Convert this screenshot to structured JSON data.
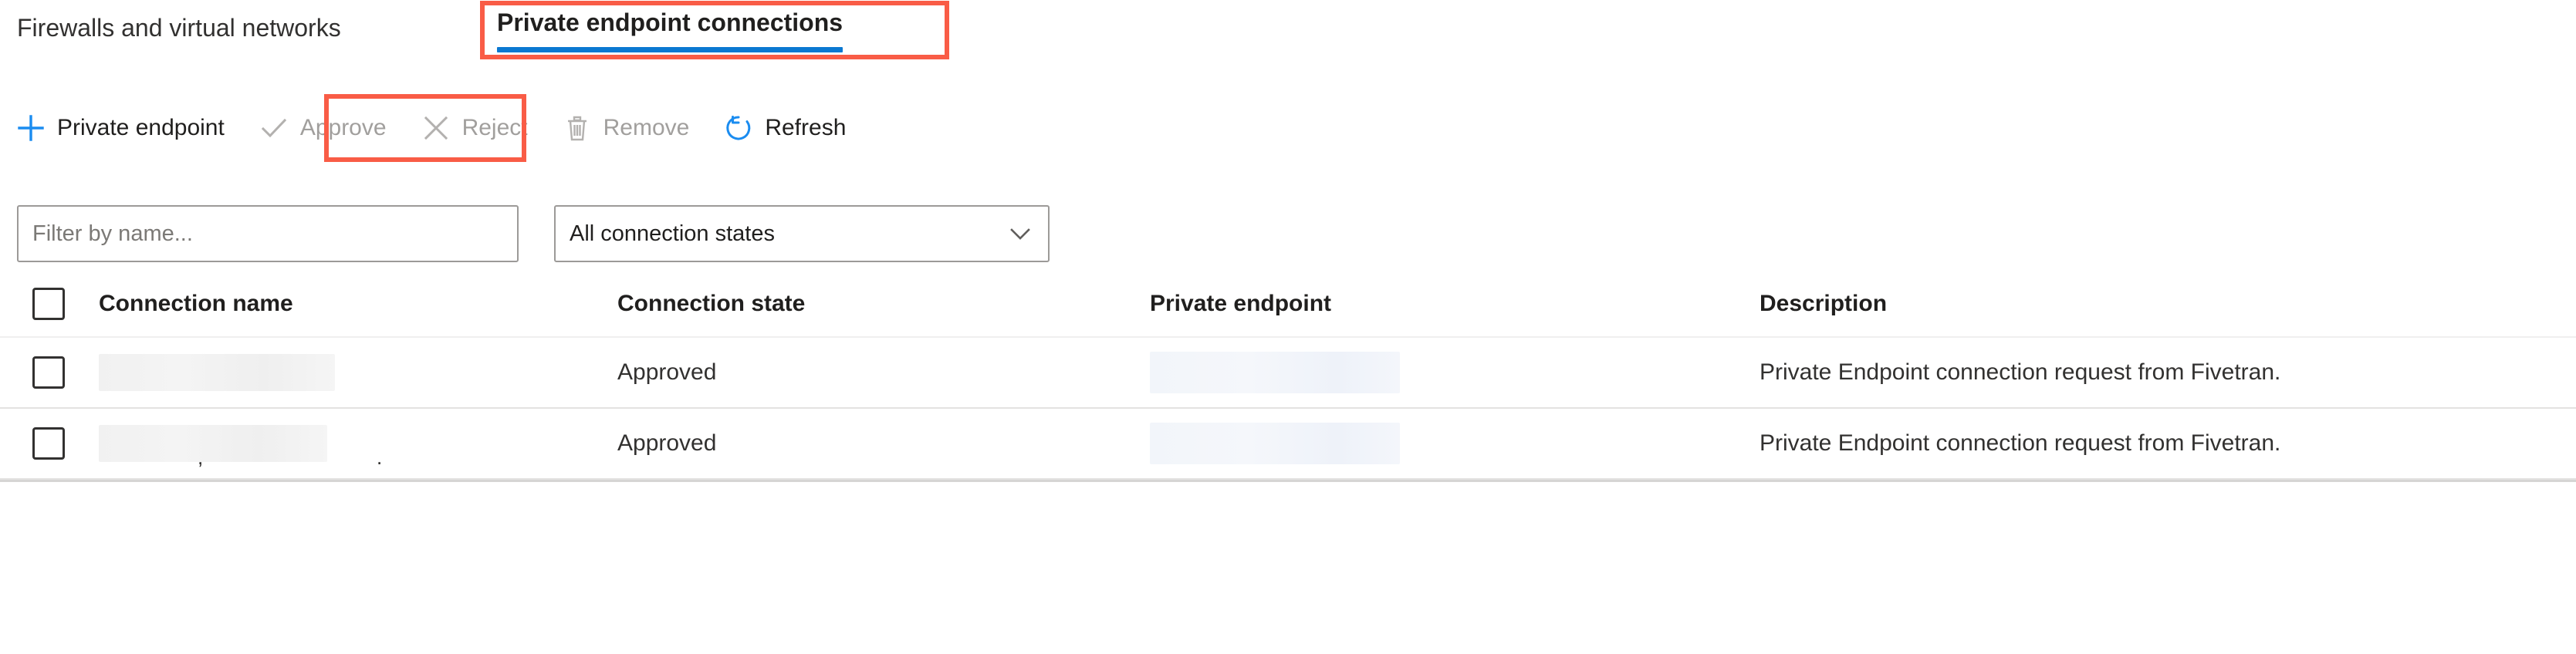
{
  "tabs": [
    {
      "id": "firewalls",
      "label": "Firewalls and virtual networks",
      "active": false
    },
    {
      "id": "private-endpoint-connections",
      "label": "Private endpoint connections",
      "active": true
    }
  ],
  "annotations": {
    "color": "#f95c46",
    "targets": [
      "private-endpoint-connections-tab",
      "approve-button"
    ]
  },
  "toolbar": {
    "private_endpoint": {
      "label": "Private endpoint",
      "icon": "plus-icon",
      "enabled": true,
      "icon_color": "#1a8cf0"
    },
    "approve": {
      "label": "Approve",
      "icon": "check-icon",
      "enabled": false,
      "icon_color": "#b3b1af"
    },
    "reject": {
      "label": "Reject",
      "icon": "close-icon",
      "enabled": false,
      "icon_color": "#b3b1af"
    },
    "remove": {
      "label": "Remove",
      "icon": "trash-icon",
      "enabled": false,
      "icon_color": "#b3b1af"
    },
    "refresh": {
      "label": "Refresh",
      "icon": "refresh-icon",
      "enabled": true,
      "icon_color": "#1a8cf0"
    }
  },
  "filters": {
    "name_filter": {
      "value": "",
      "placeholder": "Filter by name..."
    },
    "connection_state": {
      "selected": "All connection states",
      "icon": "chevron-down-icon"
    }
  },
  "table": {
    "columns": [
      {
        "key": "name",
        "label": "Connection name"
      },
      {
        "key": "state",
        "label": "Connection state"
      },
      {
        "key": "pe",
        "label": "Private endpoint"
      },
      {
        "key": "desc",
        "label": "Description"
      }
    ],
    "select_all_checked": false,
    "rows": [
      {
        "checked": false,
        "name": "",
        "name_redacted": true,
        "state": "Approved",
        "private_endpoint": "",
        "private_endpoint_redacted": true,
        "description": "Private Endpoint connection request from Fivetran."
      },
      {
        "checked": false,
        "name": "",
        "name_redacted": true,
        "state": "Approved",
        "private_endpoint": "",
        "private_endpoint_redacted": true,
        "description": "Private Endpoint connection request from Fivetran."
      }
    ]
  },
  "colors": {
    "accent_blue": "#0b78d1",
    "annotation_red": "#f95c46",
    "text_primary": "#201f1e",
    "text_disabled": "#a19f9d",
    "row_divider": "#e3e2e1"
  }
}
